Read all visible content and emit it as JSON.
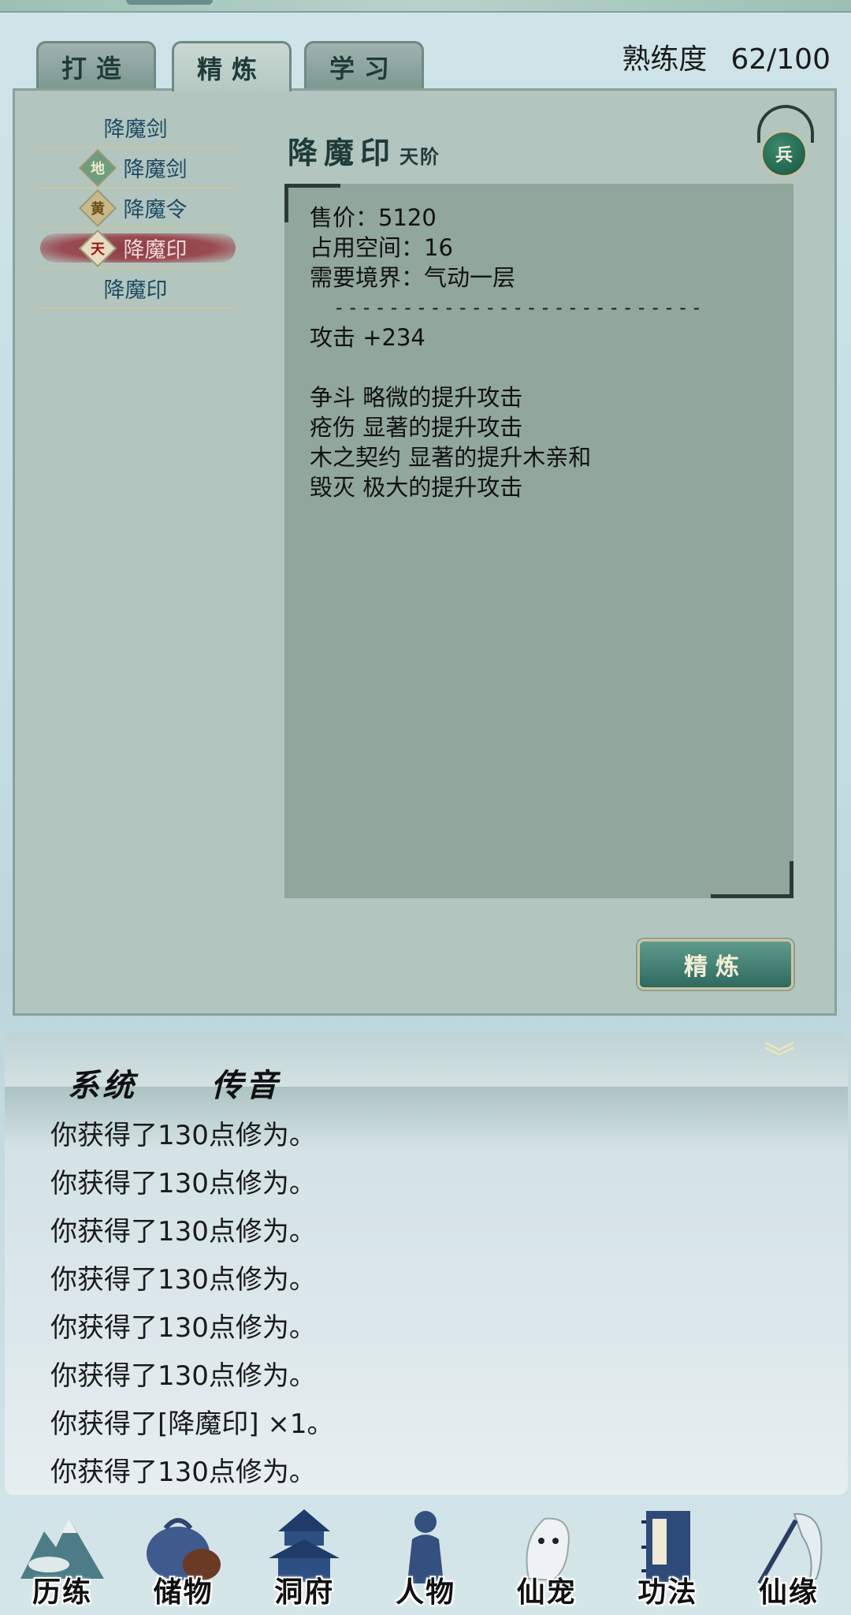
{
  "tabs": [
    {
      "label": "打造"
    },
    {
      "label": "精炼"
    },
    {
      "label": "学习"
    }
  ],
  "mastery": {
    "label": "熟练度",
    "value": "62/100"
  },
  "recipe_list": [
    {
      "name": "降魔剑",
      "grade": ""
    },
    {
      "name": "降魔剑",
      "grade": "地"
    },
    {
      "name": "降魔令",
      "grade": "黄"
    },
    {
      "name": "降魔印",
      "grade": "天"
    },
    {
      "name": "降魔印",
      "grade": ""
    }
  ],
  "item": {
    "name": "降魔印",
    "grade": "天阶",
    "emblem": "兵",
    "price": "售价：5120",
    "space": "占用空间：16",
    "realm": "需要境界：气动一层",
    "separator": "---------------------------",
    "attack": "攻击 +234",
    "traits": [
      "争斗 略微的提升攻击",
      "疮伤 显著的提升攻击",
      "木之契约 显著的提升木亲和",
      "毁灭 极大的提升攻击"
    ]
  },
  "refine_button": "精炼",
  "chat": {
    "tabs": [
      "系统",
      "传音"
    ],
    "collapse_icon": "︾",
    "messages": [
      "你获得了130点修为。",
      "你获得了130点修为。",
      "你获得了130点修为。",
      "你获得了130点修为。",
      "你获得了130点修为。",
      "你获得了130点修为。",
      "你获得了[降魔印] ×1。",
      "你获得了130点修为。"
    ]
  },
  "nav": [
    {
      "label": "历练",
      "icon": "mountain-icon"
    },
    {
      "label": "储物",
      "icon": "bag-icon"
    },
    {
      "label": "洞府",
      "icon": "pavilion-icon"
    },
    {
      "label": "人物",
      "icon": "person-icon"
    },
    {
      "label": "仙宠",
      "icon": "pet-icon"
    },
    {
      "label": "功法",
      "icon": "scroll-book-icon"
    },
    {
      "label": "仙缘",
      "icon": "crane-icon"
    }
  ]
}
